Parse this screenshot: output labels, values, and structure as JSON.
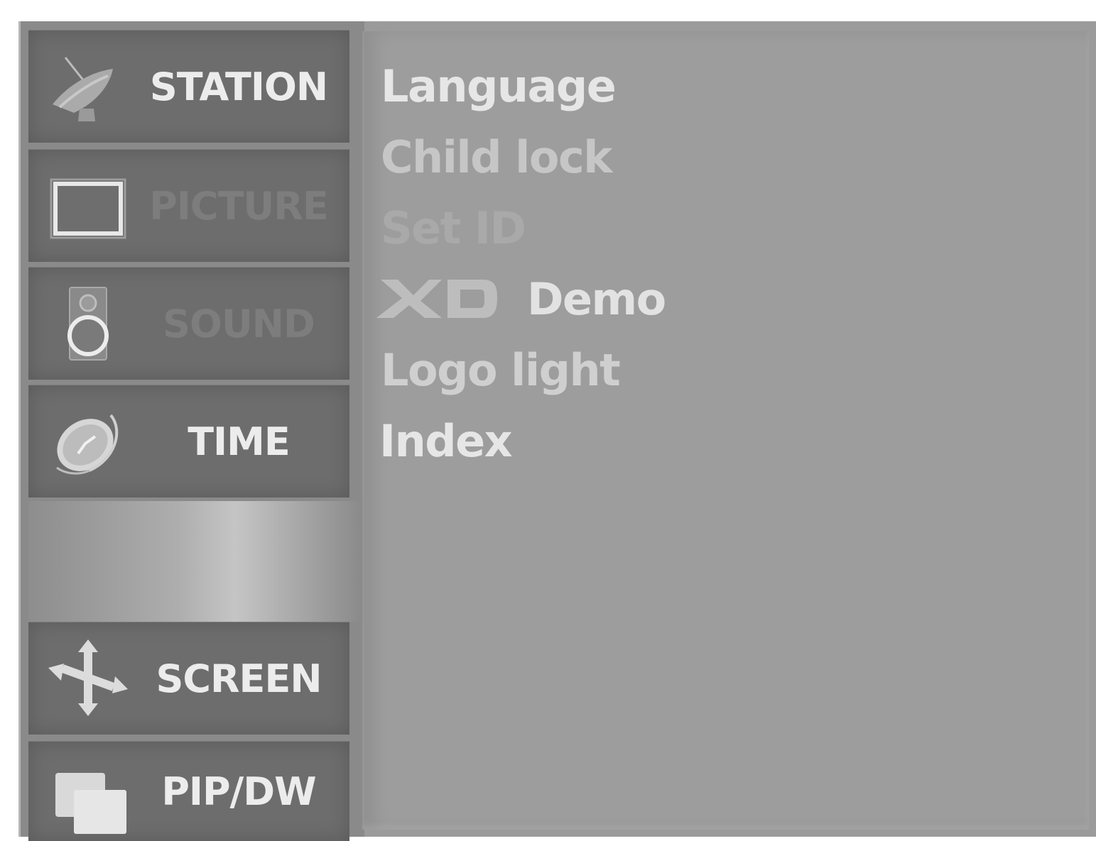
{
  "sidebar": {
    "items": [
      {
        "label": "STATION",
        "icon": "satellite-dish-icon",
        "state": "active"
      },
      {
        "label": "PICTURE",
        "icon": "monitor-icon",
        "state": "dim"
      },
      {
        "label": "SOUND",
        "icon": "speaker-icon",
        "state": "dim"
      },
      {
        "label": "TIME",
        "icon": "clock-icon",
        "state": "active"
      },
      {
        "label": "SCREEN",
        "icon": "move-arrows-icon",
        "state": "active"
      },
      {
        "label": "PIP/DW",
        "icon": "pip-windows-icon",
        "state": "active"
      }
    ]
  },
  "menu": {
    "items": [
      {
        "label": "Language",
        "color": "#e6e6e6"
      },
      {
        "label": "Child lock",
        "color": "#c6c6c6"
      },
      {
        "label": "Set ID",
        "color": "#a9a9a9"
      },
      {
        "label": "Demo",
        "logo": "XD",
        "color": "#e2e2e2"
      },
      {
        "label": "Logo light",
        "color": "#cfcfcf"
      },
      {
        "label": "Index",
        "color": "#e6e6e6"
      }
    ]
  },
  "colors": {
    "panel": "#9b9b9b",
    "tab": "#6d6d6d",
    "tab_text": "#ececec",
    "tab_text_dim": "#7d7d7d"
  }
}
